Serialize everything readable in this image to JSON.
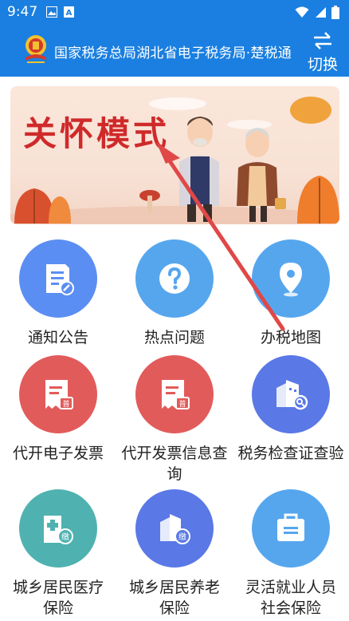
{
  "status_bar": {
    "time": "9:47",
    "left_icons": [
      "image-icon",
      "font-icon"
    ],
    "right_icons": [
      "wifi-icon",
      "signal-icon",
      "battery-icon"
    ]
  },
  "header": {
    "title": "国家税务总局湖北省电子税务局·楚税通",
    "switch_label": "切换",
    "emblem": "tax-emblem-icon"
  },
  "banner": {
    "text": "关怀模式"
  },
  "colors": {
    "header_bg": "#1a7fe0",
    "blue_circle": "#4c8ef0",
    "light_blue_circle": "#56a6ee",
    "red_circle": "#e45b5b",
    "teal_circle": "#4fb2b0",
    "indigo_circle": "#5a6fe0",
    "arrow": "#e04848"
  },
  "menu": [
    {
      "label": "通知公告",
      "icon": "notice-icon"
    },
    {
      "label": "热点问题",
      "icon": "question-icon"
    },
    {
      "label": "办税地图",
      "icon": "map-pin-icon"
    },
    {
      "label": "代开电子发票",
      "icon": "invoice-icon"
    },
    {
      "label": "代开发票信息查询",
      "icon": "invoice-query-icon"
    },
    {
      "label": "税务检查证查验",
      "icon": "building-search-icon"
    },
    {
      "label": "城乡居民医疗保险",
      "icon": "hospital-pay-icon"
    },
    {
      "label": "城乡居民养老保险",
      "icon": "building-pay-icon"
    },
    {
      "label": "灵活就业人员社会保险",
      "icon": "briefcase-icon"
    }
  ]
}
